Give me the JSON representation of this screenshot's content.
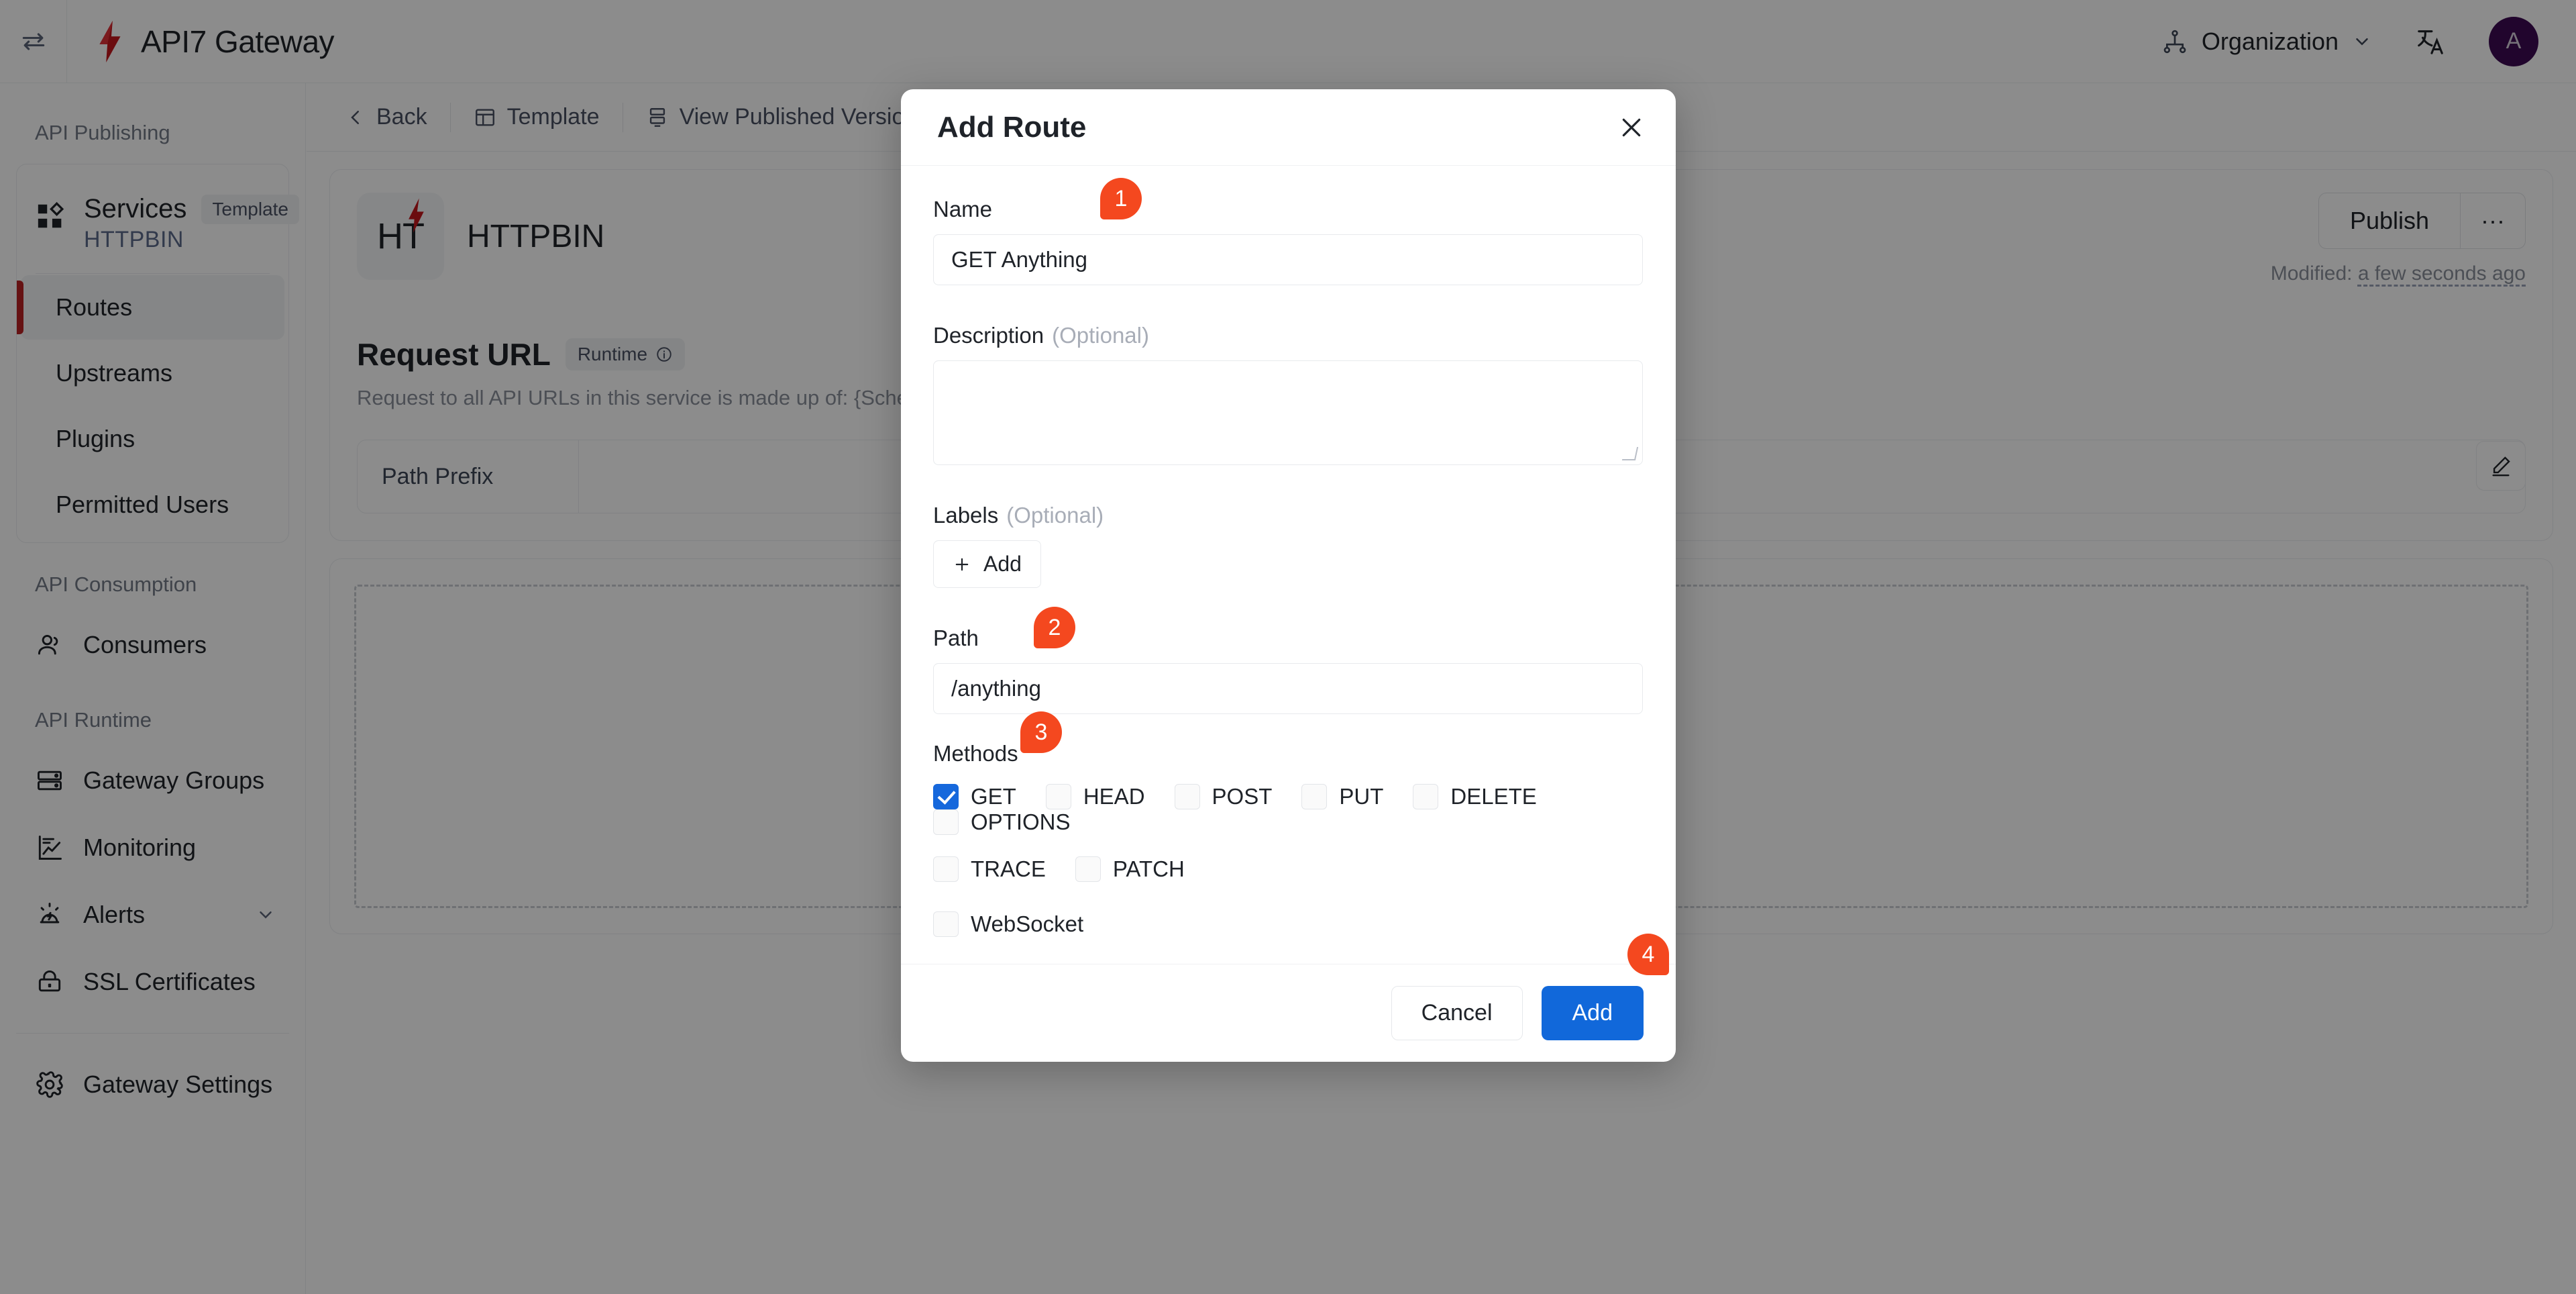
{
  "header": {
    "collapse_icon": "collapse-sidebar-icon",
    "brand_title": "API7 Gateway",
    "org_label": "Organization",
    "language_icon": "translate-icon",
    "avatar_initial": "A"
  },
  "sidebar": {
    "group_publishing": "API Publishing",
    "service_card": {
      "title": "Services",
      "badge": "Template",
      "subtitle": "HTTPBIN"
    },
    "publishing_items": [
      {
        "label": "Routes",
        "active": true
      },
      {
        "label": "Upstreams",
        "active": false
      },
      {
        "label": "Plugins",
        "active": false
      },
      {
        "label": "Permitted Users",
        "active": false
      }
    ],
    "group_consumption": "API Consumption",
    "consumption_items": [
      {
        "label": "Consumers",
        "icon": "users-icon"
      }
    ],
    "group_runtime": "API Runtime",
    "runtime_items": [
      {
        "label": "Gateway Groups",
        "icon": "server-icon",
        "chevron": false
      },
      {
        "label": "Monitoring",
        "icon": "chart-icon",
        "chevron": false
      },
      {
        "label": "Alerts",
        "icon": "alarm-icon",
        "chevron": true
      },
      {
        "label": "SSL Certificates",
        "icon": "lock-icon",
        "chevron": false
      }
    ],
    "footer_items": [
      {
        "label": "Gateway Settings",
        "icon": "gear-icon"
      }
    ]
  },
  "main": {
    "toolbar": {
      "back": "Back",
      "template": "Template",
      "published_versions": "View Published Versions"
    },
    "service": {
      "logo_text": "HT",
      "name": "HTTPBIN",
      "publish_label": "Publish",
      "more_label": "···",
      "modified_prefix": "Modified:",
      "modified_value": "a few seconds ago"
    },
    "request_url": {
      "title": "Request URL",
      "chip": "Runtime",
      "description": "Request to all API URLs in this service is made up of: {Scheme}://{Host}/{Path Prefix}/{Route Path}",
      "row_label": "Path Prefix",
      "row_value": "",
      "edit_icon": "pencil-icon"
    }
  },
  "modal": {
    "title": "Add Route",
    "close_icon": "close-icon",
    "name": {
      "label": "Name",
      "value": "GET Anything",
      "placeholder": ""
    },
    "description": {
      "label": "Description",
      "optional": "(Optional)",
      "value": "",
      "placeholder": ""
    },
    "labels": {
      "label": "Labels",
      "optional": "(Optional)",
      "add_label": "Add",
      "add_icon": "plus-icon"
    },
    "path": {
      "label": "Path",
      "value": "/anything",
      "placeholder": ""
    },
    "methods": {
      "label": "Methods",
      "row1": [
        {
          "name": "GET",
          "checked": true
        },
        {
          "name": "HEAD",
          "checked": false
        },
        {
          "name": "POST",
          "checked": false
        },
        {
          "name": "PUT",
          "checked": false
        },
        {
          "name": "DELETE",
          "checked": false
        },
        {
          "name": "OPTIONS",
          "checked": false
        }
      ],
      "row2": [
        {
          "name": "TRACE",
          "checked": false
        },
        {
          "name": "PATCH",
          "checked": false
        }
      ],
      "websocket": {
        "name": "WebSocket",
        "checked": false
      }
    },
    "footer": {
      "cancel": "Cancel",
      "add": "Add"
    },
    "steps": {
      "s1": "1",
      "s2": "2",
      "s3": "3",
      "s4": "4"
    },
    "accent_primary": "#1168da",
    "accent_step": "#f4481f"
  }
}
